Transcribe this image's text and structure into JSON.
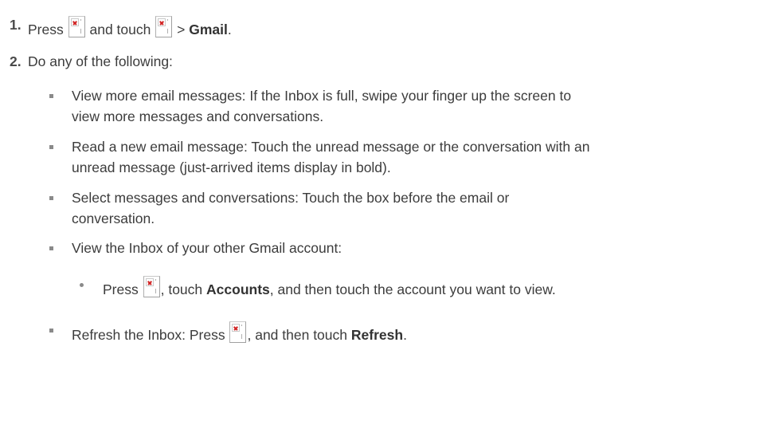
{
  "steps": [
    {
      "number": "1.",
      "text_press": "Press",
      "text_and_touch": "and touch",
      "text_gt": ">",
      "gmail": "Gmail",
      "period": "."
    },
    {
      "number": "2.",
      "text": "Do any of the following:"
    }
  ],
  "bullets": {
    "view_more": {
      "line1": "View more email messages: If the Inbox is full, swipe your finger up the screen to",
      "line2": "view more messages and conversations."
    },
    "read_new": {
      "line1": "Read a new email message: Touch the unread message or the conversation with an",
      "line2": "unread message (just-arrived items display in bold)."
    },
    "select": {
      "line1": "Select messages and conversations: Touch the box before the email or",
      "line2": "conversation."
    },
    "view_inbox": {
      "line1": "View the Inbox of your other Gmail account:"
    },
    "sub_press": {
      "text_press": "Press",
      "text_touch": ", touch",
      "accounts": "Accounts",
      "text_rest": ", and then touch the account you want to view."
    },
    "refresh": {
      "text_a": "Refresh the Inbox: Press",
      "text_b": ", and then touch",
      "refresh": "Refresh",
      "period": "."
    }
  },
  "icons": [
    "broken-image-icon"
  ]
}
